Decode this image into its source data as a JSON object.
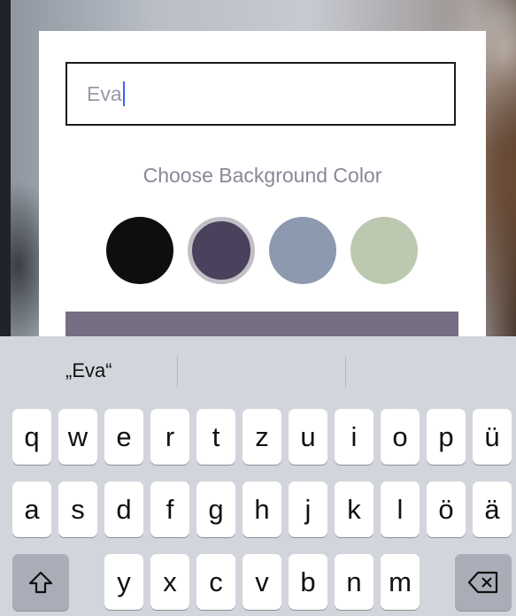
{
  "form": {
    "name_value": "Eva",
    "choose_label": "Choose Background Color",
    "swatches": [
      {
        "color": "#0d0f0e",
        "selected": false
      },
      {
        "color": "#4a425c",
        "selected": true
      },
      {
        "color": "#8d99ae",
        "selected": false
      },
      {
        "color": "#bcc8b0",
        "selected": false
      }
    ],
    "submit_color": "#766f83"
  },
  "keyboard": {
    "suggestion": "„Eva“",
    "row1": [
      "q",
      "w",
      "e",
      "r",
      "t",
      "z",
      "u",
      "i",
      "o",
      "p",
      "ü"
    ],
    "row2": [
      "a",
      "s",
      "d",
      "f",
      "g",
      "h",
      "j",
      "k",
      "l",
      "ö",
      "ä"
    ],
    "row3": [
      "y",
      "x",
      "c",
      "v",
      "b",
      "n",
      "m"
    ],
    "icons": {
      "shift": "shift-icon",
      "backspace": "backspace-icon"
    }
  }
}
